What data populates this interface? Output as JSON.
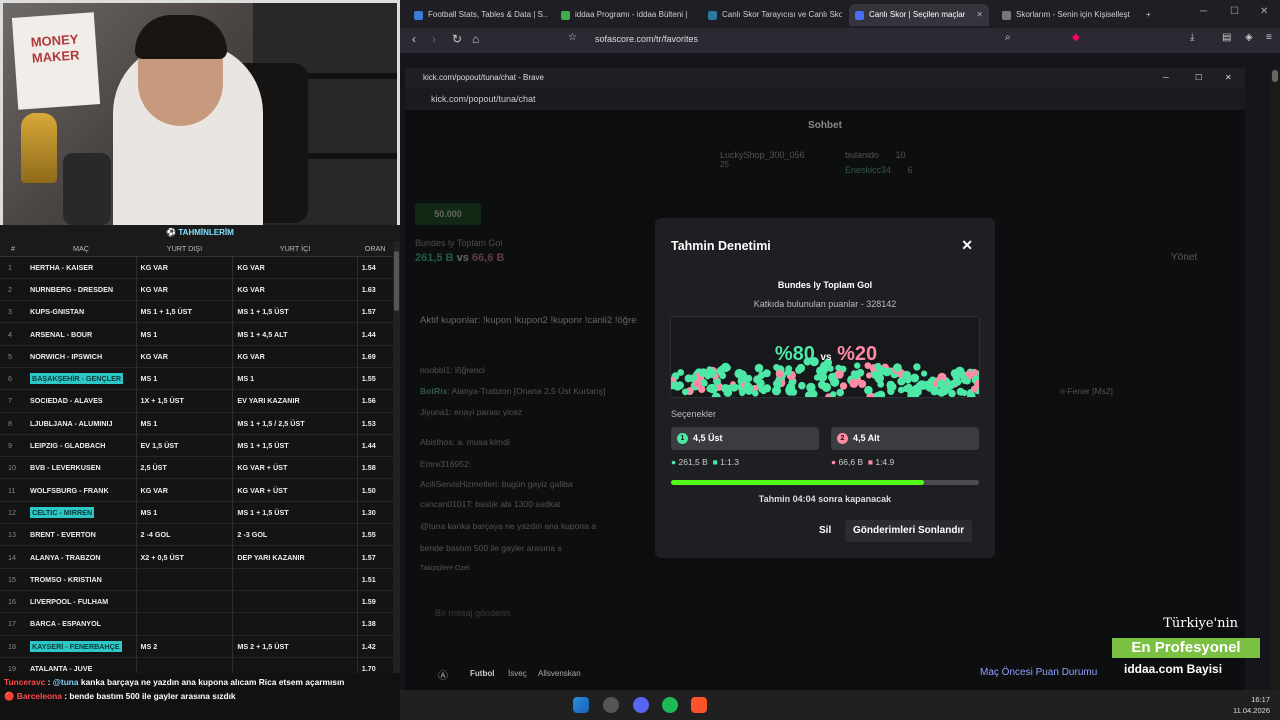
{
  "left_panel": {
    "header": "TAHMİNLERİM",
    "columns": [
      "#",
      "MAÇ",
      "YURT DIŞI",
      "YURT İÇİ",
      "ORAN"
    ],
    "rows": [
      {
        "n": "1",
        "team": "HERTHA - KAISER",
        "yd": "KG VAR",
        "yi": "KG VAR",
        "oran": "1.54",
        "hl": false
      },
      {
        "n": "2",
        "team": "NURNBERG - DRESDEN",
        "yd": "KG VAR",
        "yi": "KG VAR",
        "oran": "1.63",
        "hl": false
      },
      {
        "n": "3",
        "team": "KUPS-GNISTAN",
        "yd": "MS 1 + 1,5 ÜST",
        "yi": "MS 1 + 1,5 ÜST",
        "oran": "1.57",
        "hl": false
      },
      {
        "n": "4",
        "team": "ARSENAL - BOUR",
        "yd": "MS 1",
        "yi": "MS 1 + 4,5 ALT",
        "oran": "1.44",
        "hl": false
      },
      {
        "n": "5",
        "team": "NORWICH - IPSWICH",
        "yd": "KG VAR",
        "yi": "KG VAR",
        "oran": "1.69",
        "hl": false
      },
      {
        "n": "6",
        "team": "BAŞAKŞEHİR - GENÇLER",
        "yd": "MS 1",
        "yi": "MS 1",
        "oran": "1.55",
        "hl": true
      },
      {
        "n": "7",
        "team": "SOCIEDAD - ALAVES",
        "yd": "1X + 1,5 ÜST",
        "yi": "EV YARI KAZANIR",
        "oran": "1.56",
        "hl": false
      },
      {
        "n": "8",
        "team": "LJUBLJANA - ALUMINIJ",
        "yd": "MS 1",
        "yi": "MS 1 + 1,5 / 2,5 ÜST",
        "oran": "1.53",
        "hl": false
      },
      {
        "n": "9",
        "team": "LEIPZIG - GLADBACH",
        "yd": "EV 1,5 ÜST",
        "yi": "MS 1 + 1,5 ÜST",
        "oran": "1.44",
        "hl": false
      },
      {
        "n": "10",
        "team": "BVB - LEVERKUSEN",
        "yd": "2,5 ÜST",
        "yi": "KG VAR + ÜST",
        "oran": "1.58",
        "hl": false
      },
      {
        "n": "11",
        "team": "WOLFSBURG - FRANK",
        "yd": "KG VAR",
        "yi": "KG VAR + ÜST",
        "oran": "1.50",
        "hl": false
      },
      {
        "n": "12",
        "team": "CELTIC - MIRREN",
        "yd": "MS 1",
        "yi": "MS 1 + 1,5 ÜST",
        "oran": "1.30",
        "hl": true
      },
      {
        "n": "13",
        "team": "BRENT - EVERTON",
        "yd": "2 -4 GOL",
        "yi": "2 -3 GOL",
        "oran": "1.55",
        "hl": false
      },
      {
        "n": "14",
        "team": "ALANYA - TRABZON",
        "yd": "X2 + 0,5 ÜST",
        "yi": "DEP YARI KAZANIR",
        "oran": "1.57",
        "hl": false
      },
      {
        "n": "15",
        "team": "TROMSO - KRISTIAN",
        "yd": "",
        "yi": "",
        "oran": "1.51",
        "hl": false
      },
      {
        "n": "16",
        "team": "LIVERPOOL - FULHAM",
        "yd": "",
        "yi": "",
        "oran": "1.59",
        "hl": false
      },
      {
        "n": "17",
        "team": "BARCA - ESPANYOL",
        "yd": "",
        "yi": "",
        "oran": "1.38",
        "hl": false
      },
      {
        "n": "18",
        "team": "KAYSERİ - FENERBAHÇE",
        "yd": "MS 2",
        "yi": "MS 2 + 1,5 ÜST",
        "oran": "1.42",
        "hl": true
      },
      {
        "n": "19",
        "team": "ATALANTA - JUVE",
        "yd": "",
        "yi": "",
        "oran": "1.70",
        "hl": false
      }
    ]
  },
  "chat_overlay": {
    "line1_user": "Tunceravc",
    "line1_mention": "@tuna",
    "line1_text": "kanka barçaya ne yazdın ana kupona alıcam Rica etsem açarmısın",
    "line2_user": "Barceleona",
    "line2_text": "bende bastım 500 ile gayler arasına sızdık"
  },
  "browser": {
    "tabs": [
      {
        "title": "Football Stats, Tables & Data | S...",
        "color": "#3a7bd5"
      },
      {
        "title": "iddaa Programı - iddaa Bülteni |",
        "color": "#3fae49"
      },
      {
        "title": "Canlı Skor Tarayıcısı ve Canlı Sko",
        "color": "#37a"
      },
      {
        "title": "Canlı Skor | Seçilen maçlar",
        "color": "#4a6cf7"
      },
      {
        "title": "Skorlarım - Senin için Kişiselleşt",
        "color": "#777"
      }
    ],
    "url": "sofascore.com/tr/favorites"
  },
  "popout": {
    "window_title": "kick.com/popout/tuna/chat - Brave",
    "url": "kick.com/popout/tuna/chat",
    "chat_title": "Sohbet",
    "leader1": "LuckyShop_300_056",
    "leader1_count": "25",
    "leader2": "bulanido",
    "leader2_count": "10",
    "leader3": "Eneskicc34",
    "leader3_count": "6",
    "points": "50.000",
    "pinned_title": "Bundes ly Toplam Gol",
    "pinned_a": "261,5 B",
    "pinned_vs": "vs",
    "pinned_b": "66,6 B",
    "manage": "Yönet",
    "msg_coupon": "Aktif kuponlar: !kupon !kupon2 !kuponr !canli2 !öğre",
    "msg1": "noobbi1: lõğrenci",
    "msg2_user": "BotRix",
    "msg2": "Alanya-Trabzon [Onana 2,5 Üst Kurtarış]",
    "msg3": "Jiyuna1: enayi parası yicez",
    "msg4": "Abisthos: a. musa kimdi",
    "msg5": "Emre316952:",
    "msg6": "AciliServisHizmetleri: bugün gayiz galiba",
    "msg7": "cancan0101T: bastık abi 1300 sadkat",
    "msg8": "@tuna kanka barçaya ne yazdın ana kupona a",
    "msg9": "bende bastım 500 ile gayler arasına s",
    "followers": "Takipçilere Özel",
    "input_placeholder": "Bir mesaj gönderin",
    "right_text": "ri-Fener [Ms2]"
  },
  "modal": {
    "title": "Tahmin Denetimi",
    "prediction": "Bundes ly Toplam Gol",
    "subtitle": "Katkıda bulunulan puanlar - 328142",
    "pct_a": "%80",
    "pct_vs": "vs",
    "pct_b": "%20",
    "options_label": "Seçenekler",
    "opt1": "4,5 Üst",
    "opt2": "4,5 Alt",
    "opt1_points": "261,5 B",
    "opt1_ratio": "1:1.3",
    "opt2_points": "66,6 B",
    "opt2_ratio": "1:4.9",
    "progress_fraction": 0.82,
    "closes_text": "Tahmin 04:04 sonra kapanacak",
    "delete_btn": "Sil",
    "end_btn": "Gönderimleri Sonlandır",
    "color_a": "#4ee8a6",
    "color_b": "#ff8aa3"
  },
  "sofa": {
    "breadcrumb_a": "Futbol",
    "breadcrumb_b": "İsveç",
    "breadcrumb_c": "Allsvenskan",
    "bottom_right": "Maç Öncesi Puan Durumu"
  },
  "ad": {
    "line1": "Türkiye'nin",
    "line2": "En Profesyonel",
    "line3": "iddaa.com Bayisi"
  },
  "taskbar": {
    "time": "16:17",
    "date": "11.04.2026"
  }
}
